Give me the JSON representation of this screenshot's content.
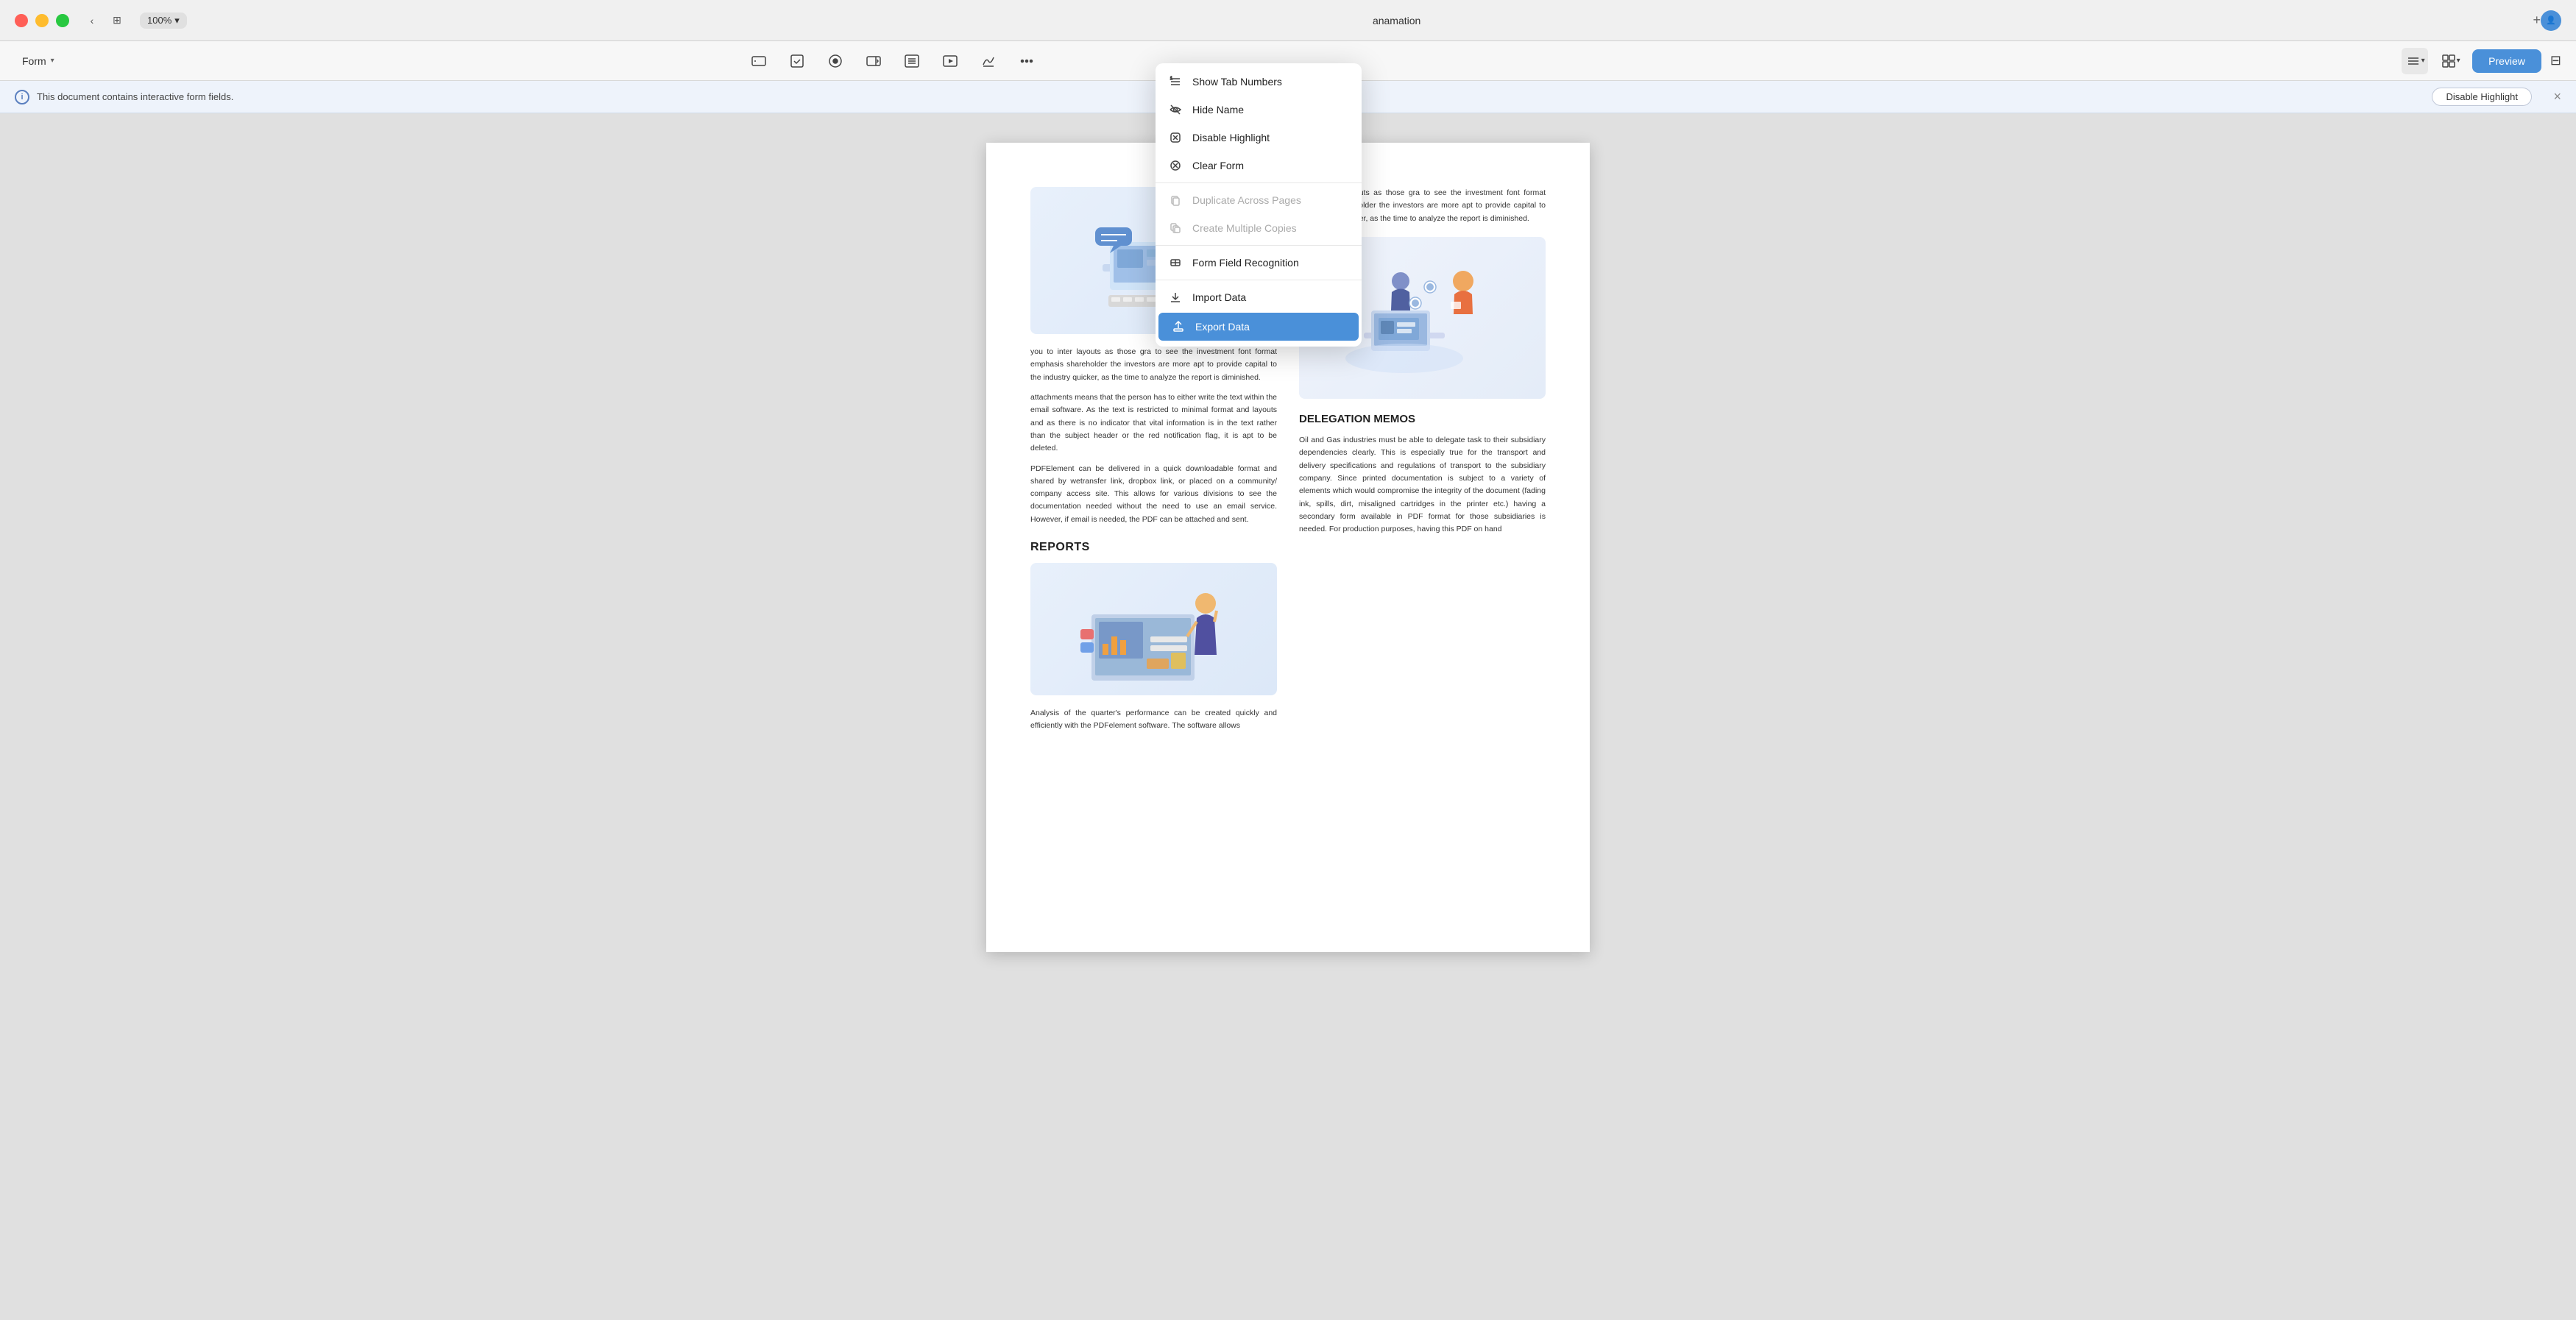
{
  "titlebar": {
    "app_name": "anamation",
    "zoom": "100%",
    "new_tab": "+",
    "traffic_lights": [
      "red",
      "yellow",
      "green"
    ]
  },
  "toolbar": {
    "form_label": "Form",
    "preview_label": "Preview",
    "icons": [
      {
        "name": "text-field-icon",
        "symbol": "⊤",
        "label": "Text Field"
      },
      {
        "name": "checkbox-icon",
        "symbol": "☑",
        "label": "Checkbox"
      },
      {
        "name": "radio-icon",
        "symbol": "◎",
        "label": "Radio"
      },
      {
        "name": "combo-icon",
        "symbol": "⊞",
        "label": "Combo"
      },
      {
        "name": "list-icon",
        "symbol": "≡",
        "label": "List"
      },
      {
        "name": "signature-icon",
        "symbol": "✎",
        "label": "Signature"
      },
      {
        "name": "more-icon",
        "symbol": "⋯",
        "label": "More"
      }
    ],
    "right_icons": [
      {
        "name": "form-menu-icon",
        "symbol": "☰",
        "label": "Form Menu"
      },
      {
        "name": "grid-icon",
        "symbol": "⋮⋮",
        "label": "Grid"
      }
    ]
  },
  "infobar": {
    "message": "This document contains interactive form fields.",
    "disable_highlight": "Disable Highlight",
    "close": "×"
  },
  "dropdown_menu": {
    "items": [
      {
        "id": "show-tab-numbers",
        "label": "Show Tab Numbers",
        "icon": "↕",
        "disabled": false,
        "active": false
      },
      {
        "id": "hide-name",
        "label": "Hide Name",
        "icon": "👁",
        "disabled": false,
        "active": false
      },
      {
        "id": "disable-highlight",
        "label": "Disable Highlight",
        "icon": "🚫",
        "disabled": false,
        "active": false
      },
      {
        "id": "clear-form",
        "label": "Clear Form",
        "icon": "⊘",
        "disabled": false,
        "active": false
      },
      {
        "id": "duplicate-across-pages",
        "label": "Duplicate Across Pages",
        "icon": "⧉",
        "disabled": true,
        "active": false
      },
      {
        "id": "create-multiple-copies",
        "label": "Create Multiple Copies",
        "icon": "⧉",
        "disabled": true,
        "active": false
      },
      {
        "id": "form-field-recognition",
        "label": "Form Field Recognition",
        "icon": "◫",
        "disabled": false,
        "active": false
      },
      {
        "id": "import-data",
        "label": "Import Data",
        "icon": "↑",
        "disabled": false,
        "active": false
      },
      {
        "id": "export-data",
        "label": "Export Data",
        "icon": "⬆",
        "disabled": false,
        "active": true
      }
    ]
  },
  "pdf": {
    "left_body1": "you to inter layouts as those gra to see the investment font format emphasis shareholder the investors are more apt to provide capital to the industry quicker, as the time to analyze the report is diminished.",
    "left_body2": "attachments means that the person has to either write the text within the email software. As the text is restricted to minimal format and layouts and as there is no indicator that vital information is in the text rather than the subject header or the red notification flag, it is apt to be deleted.",
    "left_body3": "PDFElement can be delivered in a quick downloadable format and shared by wetransfer link, dropbox link, or placed on a community/ company access site. This allows for various divisions to see the documentation needed without the need to use an email service. However, if email is needed, the PDF can be attached and sent.",
    "reports_title": "REPORTS",
    "left_body4": "Analysis of the quarter's performance can be created quickly and efficiently with the PDFelement software. The software allows",
    "delegation_title": "DELEGATION MEMOS",
    "right_body1": "Oil and Gas industries must be able to delegate task to their subsidiary dependencies clearly. This is especially true for the transport and delivery specifications and regulations of transport to the subsidiary company. Since printed documentation is subject to a variety of elements which would compromise the integrity of the document (fading ink, spills, dirt, misaligned cartridges in the printer etc.) having a secondary form available in PDF format for those subsidiaries is needed. For production purposes, having this PDF on hand"
  }
}
